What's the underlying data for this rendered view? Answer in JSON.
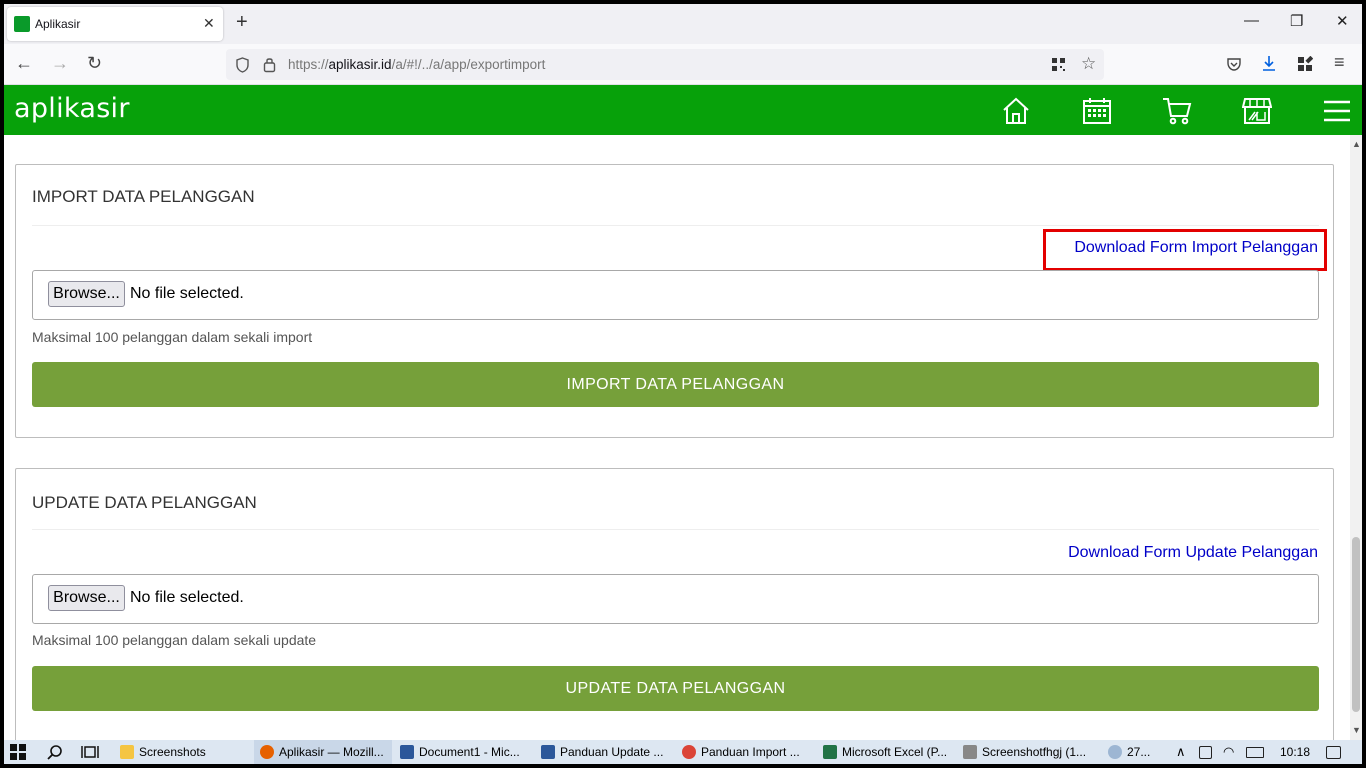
{
  "browser": {
    "tab_title": "Aplikasir",
    "tab_close": "✕",
    "new_tab": "+",
    "window_controls": [
      "—",
      "❐",
      "✕"
    ],
    "url_prefix": "https://",
    "url_host": "aplikasir.id",
    "url_path": "/a/#!/../a/app/exportimport"
  },
  "app": {
    "logo": "aplikasir",
    "header_icons": [
      "home-icon",
      "calendar-icon",
      "cart-icon",
      "store-icon",
      "menu-icon"
    ],
    "brand_color": "#07a10a",
    "button_color": "#76a03a"
  },
  "import_panel": {
    "title": "IMPORT DATA PELANGGAN",
    "download_link": "Download Form Import Pelanggan",
    "browse_label": "Browse...",
    "file_status": "No file selected.",
    "hint": "Maksimal 100 pelanggan dalam sekali import",
    "action_label": "IMPORT DATA PELANGGAN"
  },
  "update_panel": {
    "title": "UPDATE DATA PELANGGAN",
    "download_link": "Download Form Update Pelanggan",
    "browse_label": "Browse...",
    "file_status": "No file selected.",
    "hint": "Maksimal 100 pelanggan dalam sekali update",
    "action_label": "UPDATE DATA PELANGGAN"
  },
  "taskbar": {
    "items": [
      {
        "label": "Screenshots",
        "icon": "folder-icon",
        "color": "#f5c542"
      },
      {
        "label": "Aplikasir — Mozill...",
        "icon": "firefox-icon",
        "color": "#e66000"
      },
      {
        "label": "Document1 - Mic...",
        "icon": "word-icon",
        "color": "#2b579a"
      },
      {
        "label": "Panduan Update ...",
        "icon": "word-icon",
        "color": "#2b579a"
      },
      {
        "label": "Panduan Import ...",
        "icon": "chrome-icon",
        "color": "#db4437"
      },
      {
        "label": "Microsoft Excel (P...",
        "icon": "excel-icon",
        "color": "#217346"
      },
      {
        "label": "Screenshotfhgj (1...",
        "icon": "paint-icon",
        "color": "#888888"
      }
    ],
    "weather": "27...",
    "clock": "10:18"
  }
}
